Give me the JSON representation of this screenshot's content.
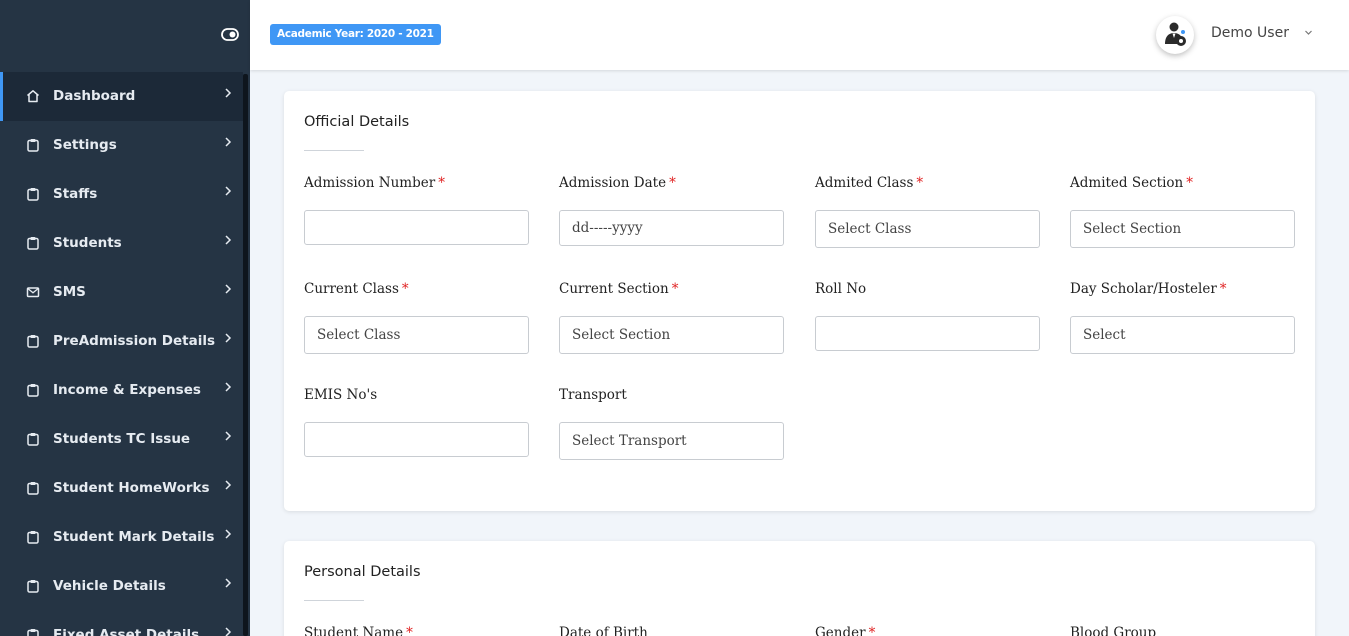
{
  "header": {
    "academic_year": "Academic Year: 2020 - 2021",
    "user_name": "Demo User"
  },
  "sidebar": {
    "items": [
      {
        "label": "Dashboard",
        "icon": "home-icon",
        "active": true
      },
      {
        "label": "Settings",
        "icon": "clipboard-icon"
      },
      {
        "label": "Staffs",
        "icon": "clipboard-icon"
      },
      {
        "label": "Students",
        "icon": "clipboard-icon"
      },
      {
        "label": "SMS",
        "icon": "mail-icon"
      },
      {
        "label": "PreAdmission Details",
        "icon": "clipboard-icon"
      },
      {
        "label": "Income & Expenses",
        "icon": "clipboard-icon"
      },
      {
        "label": "Students TC Issue",
        "icon": "clipboard-icon"
      },
      {
        "label": "Student HomeWorks",
        "icon": "clipboard-icon"
      },
      {
        "label": "Student Mark Details",
        "icon": "clipboard-icon"
      },
      {
        "label": "Vehicle Details",
        "icon": "clipboard-icon"
      },
      {
        "label": "Fixed Asset Details",
        "icon": "clipboard-icon"
      }
    ]
  },
  "official": {
    "title": "Official Details",
    "fields": {
      "admission_number": {
        "label": "Admission Number",
        "value": ""
      },
      "admission_date": {
        "label": "Admission Date",
        "placeholder": "dd-----yyyy"
      },
      "admited_class": {
        "label": "Admited Class",
        "value": "Select Class"
      },
      "admited_section": {
        "label": "Admited Section",
        "value": "Select Section"
      },
      "current_class": {
        "label": "Current Class",
        "value": "Select Class"
      },
      "current_section": {
        "label": "Current Section",
        "value": "Select Section"
      },
      "roll_no": {
        "label": "Roll No",
        "value": ""
      },
      "day_scholar": {
        "label": "Day Scholar/Hosteler",
        "value": "Select"
      },
      "emis_no": {
        "label": "EMIS No's",
        "value": ""
      },
      "transport": {
        "label": "Transport",
        "value": "Select Transport"
      }
    },
    "required_mark": "*"
  },
  "personal": {
    "title": "Personal Details",
    "fields": {
      "student_name": {
        "label": "Student Name"
      },
      "date_of_birth": {
        "label": "Date of Birth"
      },
      "gender": {
        "label": "Gender"
      },
      "blood_group": {
        "label": "Blood Group"
      }
    }
  },
  "colors": {
    "sidebar_bg": "#253444",
    "accent": "#3f97f5",
    "required": "#e02020"
  }
}
